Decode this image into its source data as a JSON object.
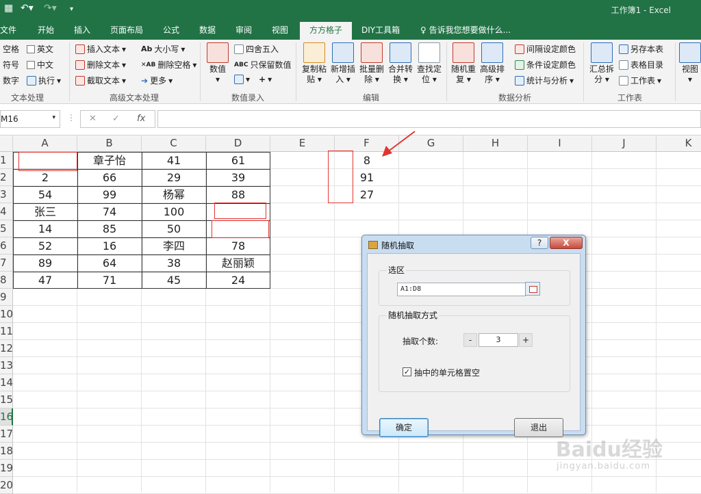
{
  "window": {
    "title": "工作簿1 - Excel"
  },
  "ribbon_tabs": [
    "文件",
    "开始",
    "插入",
    "页面布局",
    "公式",
    "数据",
    "审阅",
    "视图",
    "方方格子",
    "DIY工具箱"
  ],
  "active_tab": "方方格子",
  "tell_me": "告诉我您想要做什么...",
  "ribbon": {
    "text_processing": {
      "items": [
        "空格",
        "英文",
        "符号",
        "中文",
        "数字",
        "执行"
      ],
      "label": "文本处理"
    },
    "advanced_text": {
      "items": [
        "插入文本",
        "删除文本",
        "截取文本",
        "大小写",
        "删除空格",
        "更多"
      ],
      "label": "高级文本处理"
    },
    "data_entry": {
      "items": [
        "数值",
        "四舍五入",
        "只保留数值"
      ],
      "label": "数值录入"
    },
    "edit": {
      "items": [
        "复制粘贴",
        "新增插入",
        "批量删除",
        "合并转换",
        "查找定位"
      ],
      "label": "编辑"
    },
    "data_analysis": {
      "items": [
        "随机重复",
        "高级排序",
        "间隔设定颜色",
        "条件设定颜色",
        "统计与分析"
      ],
      "label": "数据分析"
    },
    "worksheet": {
      "items": [
        "汇总拆分",
        "另存本表",
        "表格目录",
        "工作表"
      ],
      "label": "工作表"
    },
    "view": {
      "label": "视图"
    }
  },
  "formula_bar": {
    "name_box": "M16",
    "value": ""
  },
  "columns": [
    "A",
    "B",
    "C",
    "D",
    "E",
    "F",
    "G",
    "H",
    "I",
    "J",
    "K"
  ],
  "rows": [
    "1",
    "2",
    "3",
    "4",
    "5",
    "6",
    "7",
    "8",
    "9",
    "10",
    "11",
    "12",
    "13",
    "14",
    "15",
    "16",
    "17",
    "18",
    "19",
    "20"
  ],
  "active_row": "16",
  "cells": {
    "A1": "",
    "B1": "章子怡",
    "C1": "41",
    "D1": "61",
    "A2": "2",
    "B2": "66",
    "C2": "29",
    "D2": "39",
    "A3": "54",
    "B3": "99",
    "C3": "杨幂",
    "D3": "88",
    "A4": "张三",
    "B4": "74",
    "C4": "100",
    "D4": "",
    "A5": "14",
    "B5": "85",
    "C5": "50",
    "D5": "",
    "A6": "52",
    "B6": "16",
    "C6": "李四",
    "D6": "78",
    "A7": "89",
    "B7": "64",
    "C7": "38",
    "D7": "赵丽颖",
    "A8": "47",
    "B8": "71",
    "C8": "45",
    "D8": "24",
    "F1": "8",
    "F2": "91",
    "F3": "27"
  },
  "dialog": {
    "title": "随机抽取",
    "help": "?",
    "close": "X",
    "section_range": "选区",
    "range_value": "A1:D8",
    "section_method": "随机抽取方式",
    "count_label": "抽取个数:",
    "minus": "-",
    "count_value": "3",
    "plus": "+",
    "clear_label": "抽中的单元格置空",
    "clear_checked": true,
    "ok": "确定",
    "exit": "退出"
  },
  "watermark": {
    "text": "Baidu经验",
    "url": "jingyan.baidu.com"
  },
  "accent": "#217346",
  "highlight": "#e2342f"
}
